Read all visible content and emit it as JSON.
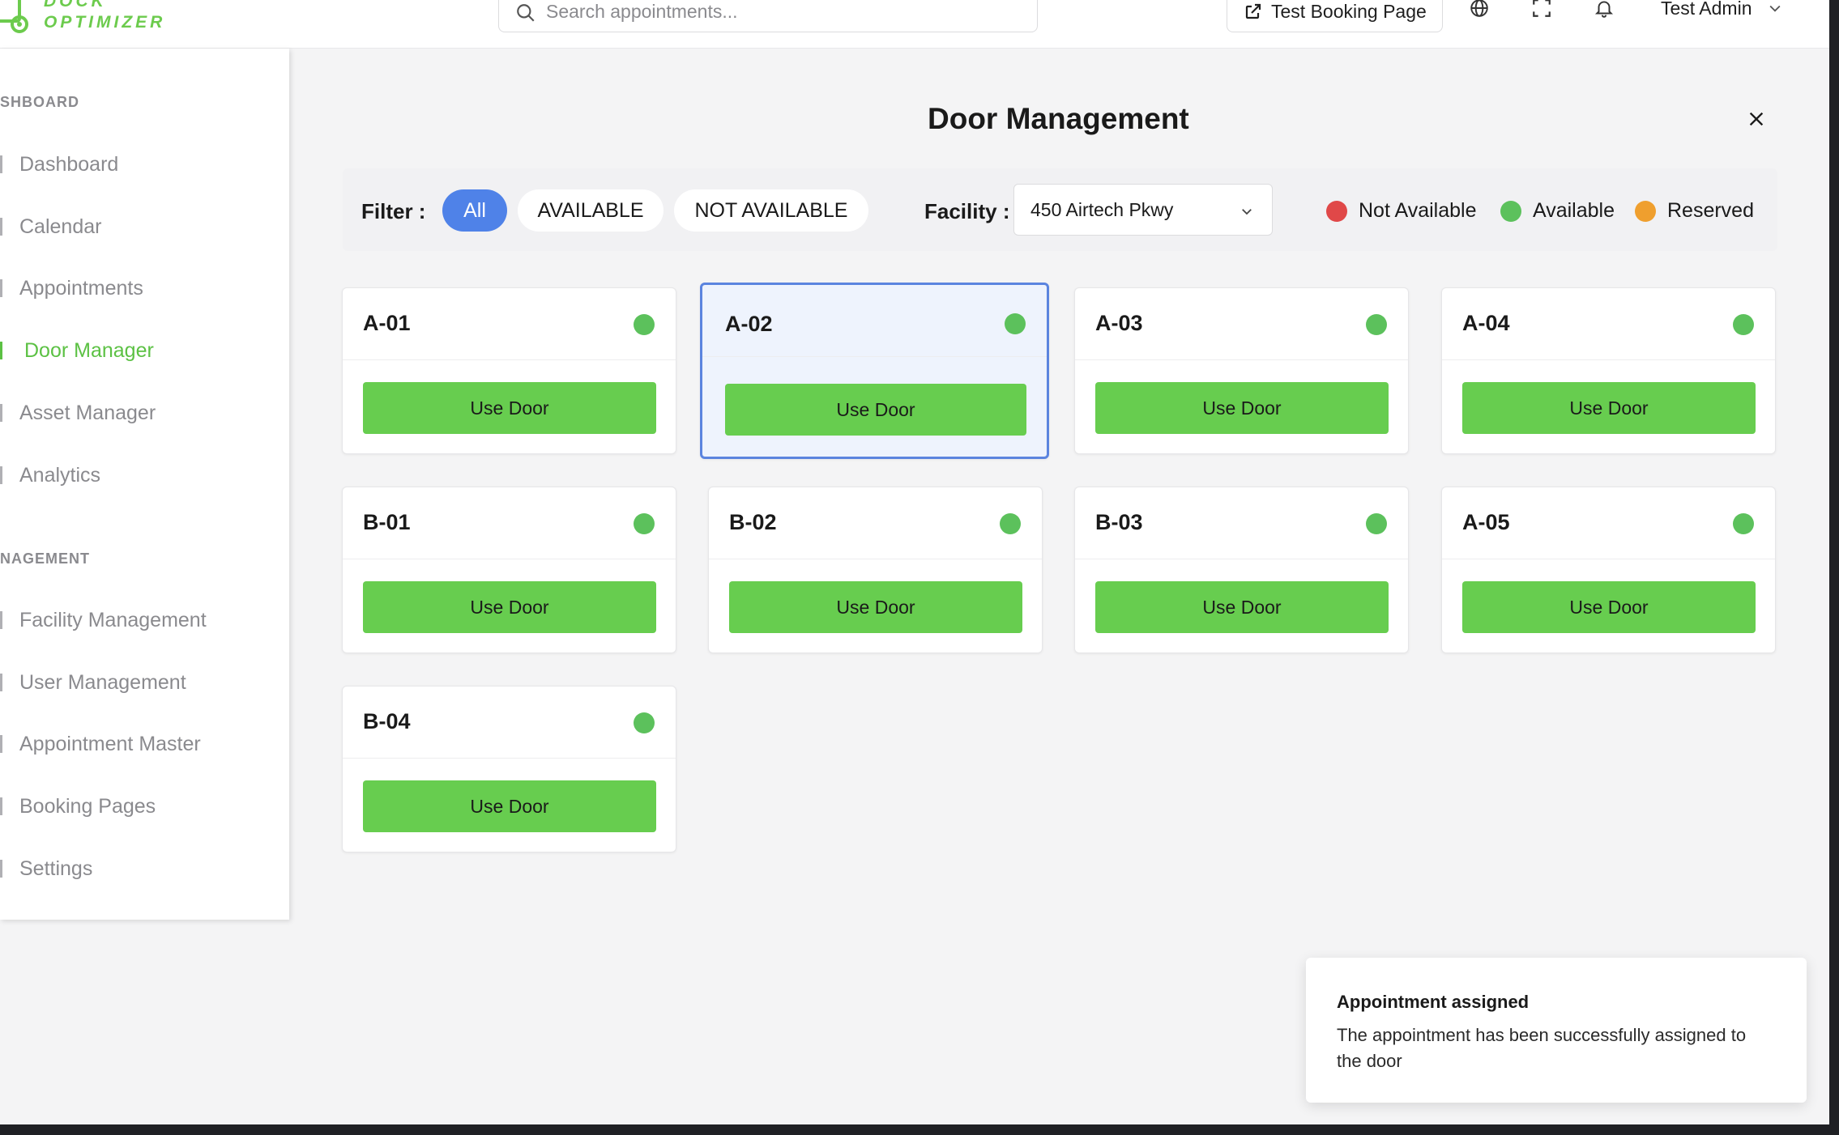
{
  "header": {
    "logo_text": "DOCK OPTIMIZER",
    "search_placeholder": "Search appointments...",
    "test_booking_label": "Test Booking Page",
    "user_name": "Test Admin"
  },
  "sidebar": {
    "section_dashboard": "SHBOARD",
    "section_management": "NAGEMENT",
    "items": [
      {
        "label": "Dashboard"
      },
      {
        "label": "Calendar"
      },
      {
        "label": "Appointments"
      },
      {
        "label": "Door Manager"
      },
      {
        "label": "Asset Manager"
      },
      {
        "label": "Analytics"
      },
      {
        "label": "Facility Management"
      },
      {
        "label": "User Management"
      },
      {
        "label": "Appointment Master"
      },
      {
        "label": "Booking Pages"
      },
      {
        "label": "Settings"
      }
    ]
  },
  "modal": {
    "title": "Door Management",
    "filter_label": "Filter :",
    "filters": [
      "All",
      "AVAILABLE",
      "NOT AVAILABLE"
    ],
    "active_filter": "All",
    "facility_label": "Facility :",
    "facility_value": "450 Airtech Pkwy",
    "legend": [
      {
        "label": "Not Available",
        "color": "#e04848"
      },
      {
        "label": "Available",
        "color": "#5cc15c"
      },
      {
        "label": "Reserved",
        "color": "#ef9f2e"
      }
    ],
    "doors": [
      {
        "name": "A-01",
        "status": "Available",
        "action": "Use Door"
      },
      {
        "name": "A-02",
        "status": "Available",
        "action": "Use Door"
      },
      {
        "name": "A-03",
        "status": "Available",
        "action": "Use Door"
      },
      {
        "name": "A-04",
        "status": "Available",
        "action": "Use Door"
      },
      {
        "name": "B-01",
        "status": "Available",
        "action": "Use Door"
      },
      {
        "name": "B-02",
        "status": "Available",
        "action": "Use Door"
      },
      {
        "name": "B-03",
        "status": "Available",
        "action": "Use Door"
      },
      {
        "name": "A-05",
        "status": "Available",
        "action": "Use Door"
      },
      {
        "name": "B-04",
        "status": "Available",
        "action": "Use Door"
      }
    ],
    "selected_door": "A-02"
  },
  "toast": {
    "title": "Appointment assigned",
    "message": "The appointment has been successfully assigned to the door"
  },
  "colors": {
    "accent_green": "#67cd4f",
    "active_blue": "#4f82e8"
  }
}
